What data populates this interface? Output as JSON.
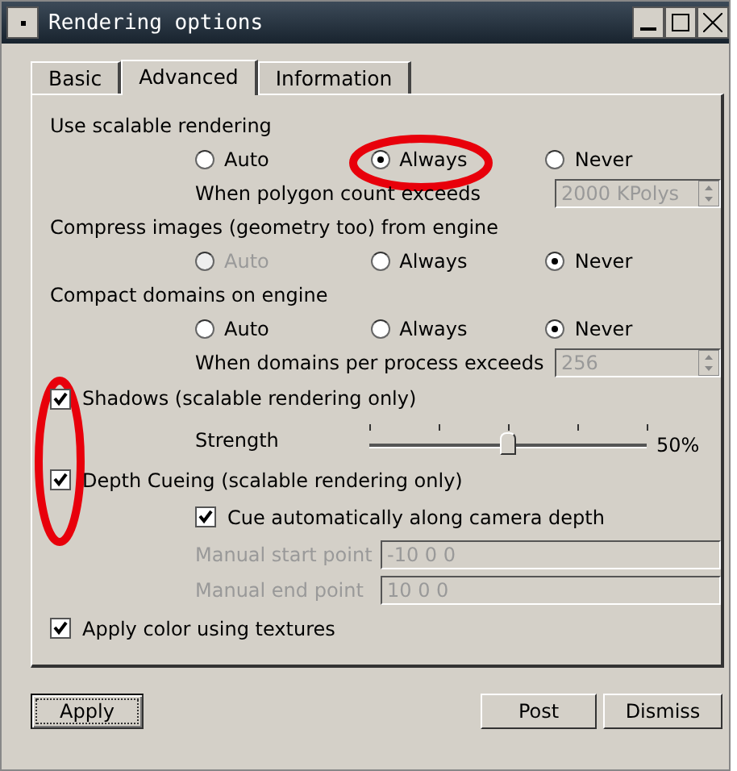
{
  "window": {
    "title": "Rendering options"
  },
  "tabs": [
    {
      "label": "Basic",
      "selected": false
    },
    {
      "label": "Advanced",
      "selected": true
    },
    {
      "label": "Information",
      "selected": false
    }
  ],
  "radio_groups": [
    {
      "label": "Use scalable rendering",
      "options": [
        {
          "label": "Auto",
          "selected": false,
          "disabled": false,
          "circled": false
        },
        {
          "label": "Always",
          "selected": true,
          "disabled": false,
          "circled": true
        },
        {
          "label": "Never",
          "selected": false,
          "disabled": false,
          "circled": false
        }
      ],
      "field": {
        "label": "When polygon count exceeds",
        "value": "2000 KPolys",
        "disabled": true
      }
    },
    {
      "label": "Compress images (geometry too) from engine",
      "options": [
        {
          "label": "Auto",
          "selected": false,
          "disabled": true,
          "circled": false
        },
        {
          "label": "Always",
          "selected": false,
          "disabled": false,
          "circled": false
        },
        {
          "label": "Never",
          "selected": true,
          "disabled": false,
          "circled": false
        }
      ]
    },
    {
      "label": "Compact domains on engine",
      "options": [
        {
          "label": "Auto",
          "selected": false,
          "disabled": false,
          "circled": false
        },
        {
          "label": "Always",
          "selected": false,
          "disabled": false,
          "circled": false
        },
        {
          "label": "Never",
          "selected": true,
          "disabled": false,
          "circled": false
        }
      ],
      "field": {
        "label": "When domains per process exceeds",
        "value": "256",
        "disabled": true
      }
    }
  ],
  "shading": {
    "circled": true,
    "shadows": {
      "label": "Shadows (scalable rendering only)",
      "checked": true
    },
    "strength": {
      "label": "Strength",
      "level": 0.5,
      "reading": "50%"
    },
    "depth_cueing": {
      "label": "Depth Cueing (scalable rendering only)",
      "checked": true
    },
    "cue_auto": {
      "label": "Cue automatically along camera depth",
      "checked": true
    },
    "manual_fields": [
      {
        "label": "Manual start point",
        "value": "-10 0 0",
        "disabled": true
      },
      {
        "label": "Manual end point",
        "value": "10 0 0",
        "disabled": true
      }
    ]
  },
  "apply_color": {
    "label": "Apply color using textures",
    "checked": true
  },
  "buttons": [
    {
      "label": "Apply",
      "focused": true
    },
    {
      "label": "Post",
      "focused": false
    },
    {
      "label": "Dismiss",
      "focused": false
    }
  ]
}
